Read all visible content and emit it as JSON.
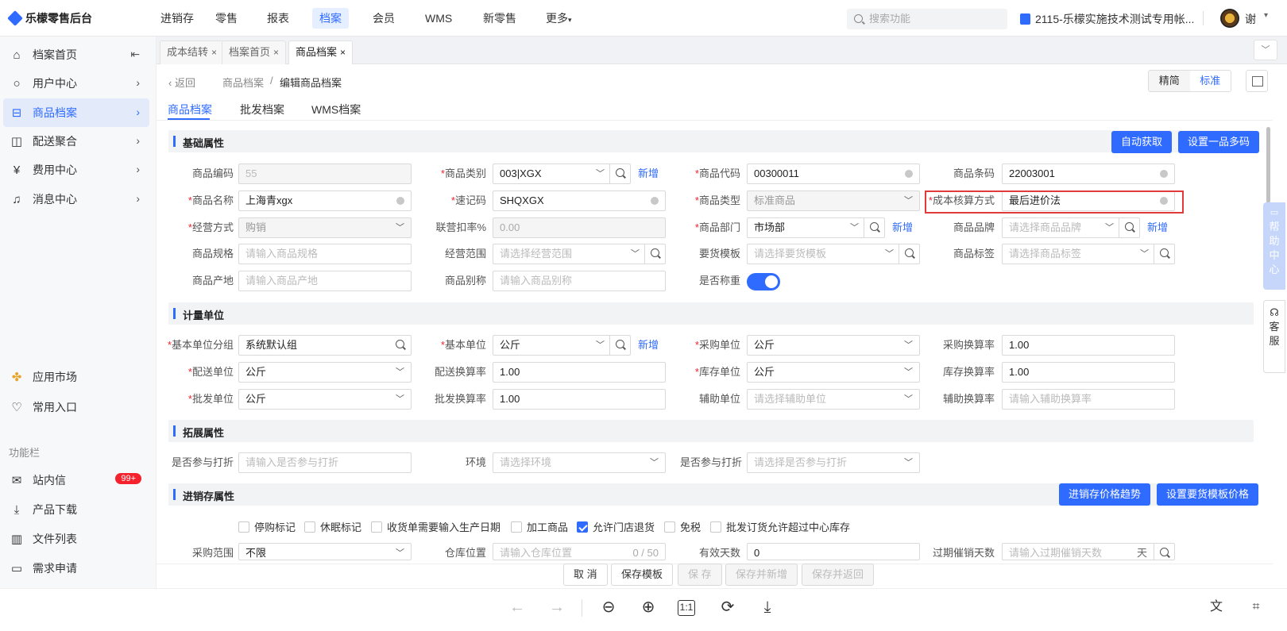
{
  "app": {
    "logo": "乐檬零售后台"
  },
  "topnav": [
    "进销存",
    "零售",
    "报表",
    "档案",
    "会员",
    "WMS",
    "新零售",
    "更多"
  ],
  "topnav_active": 3,
  "search": {
    "placeholder": "搜索功能"
  },
  "account": "2115-乐檬实施技术测试专用帐...",
  "user": "谢",
  "sidebar": {
    "items": [
      {
        "label": "档案首页",
        "icon": "home-icon"
      },
      {
        "label": "用户中心",
        "icon": "user-icon"
      },
      {
        "label": "商品档案",
        "icon": "product-icon"
      },
      {
        "label": "配送聚合",
        "icon": "delivery-icon"
      },
      {
        "label": "费用中心",
        "icon": "yen-icon"
      },
      {
        "label": "消息中心",
        "icon": "bell-icon"
      }
    ],
    "bottom": [
      {
        "label": "应用市场",
        "icon": "appstore-icon"
      },
      {
        "label": "常用入口",
        "icon": "heart-icon"
      }
    ],
    "fn_label": "功能栏",
    "fn_items": [
      {
        "label": "站内信",
        "icon": "mail-icon",
        "badge": "99+"
      },
      {
        "label": "产品下载",
        "icon": "download-icon"
      },
      {
        "label": "文件列表",
        "icon": "file-chart-icon"
      },
      {
        "label": "需求申请",
        "icon": "message-icon"
      }
    ]
  },
  "page_tabs": [
    "成本结转",
    "档案首页",
    "商品档案"
  ],
  "breadcrumb": {
    "back": "返回",
    "parent": "商品档案",
    "sep": "/",
    "current": "编辑商品档案"
  },
  "view_mode": {
    "simple": "精简",
    "standard": "标准"
  },
  "subtabs": [
    "商品档案",
    "批发档案",
    "WMS档案"
  ],
  "sections": {
    "basic": "基础属性",
    "unit": "计量单位",
    "ext": "拓展属性",
    "inv": "进销存属性"
  },
  "buttons": {
    "auto_get": "自动获取",
    "multi_code": "设置一品多码",
    "price_trend": "进销存价格趋势",
    "tpl_price": "设置要货模板价格",
    "add": "新增"
  },
  "basic": {
    "code_label": "商品编码",
    "code": "55",
    "category_label": "商品类别",
    "category": "003|XGX",
    "item_code_label": "商品代码",
    "item_code": "00300011",
    "barcode_label": "商品条码",
    "barcode": "22003001",
    "name_label": "商品名称",
    "name": "上海青xgx",
    "quick_label": "速记码",
    "quick": "SHQXGX",
    "type_label": "商品类型",
    "type": "标准商品",
    "cost_label": "成本核算方式",
    "cost": "最后进价法",
    "biz_label": "经营方式",
    "biz": "购销",
    "discount_label": "联营扣率%",
    "discount": "0.00",
    "dept_label": "商品部门",
    "dept": "市场部",
    "brand_label": "商品品牌",
    "brand_ph": "请选择商品品牌",
    "spec_label": "商品规格",
    "spec_ph": "请输入商品规格",
    "scope_label": "经营范围",
    "scope_ph": "请选择经营范围",
    "tpl_label": "要货模板",
    "tpl_ph": "请选择要货模板",
    "tag_label": "商品标签",
    "tag_ph": "请选择商品标签",
    "origin_label": "商品产地",
    "origin_ph": "请输入商品产地",
    "alias_label": "商品别称",
    "alias_ph": "请输入商品别称",
    "weigh_label": "是否称重"
  },
  "unit": {
    "group_label": "基本单位分组",
    "group": "系统默认组",
    "base_label": "基本单位",
    "base": "公斤",
    "purchase_label": "采购单位",
    "purchase": "公斤",
    "purchase_rate_label": "采购换算率",
    "purchase_rate": "1.00",
    "delivery_label": "配送单位",
    "delivery": "公斤",
    "delivery_rate_label": "配送换算率",
    "delivery_rate": "1.00",
    "stock_label": "库存单位",
    "stock": "公斤",
    "stock_rate_label": "库存换算率",
    "stock_rate": "1.00",
    "wholesale_label": "批发单位",
    "wholesale": "公斤",
    "wholesale_rate_label": "批发换算率",
    "wholesale_rate": "1.00",
    "aux_label": "辅助单位",
    "aux_ph": "请选择辅助单位",
    "aux_rate_label": "辅助换算率",
    "aux_rate_ph": "请输入辅助换算率"
  },
  "ext": {
    "disc1_label": "是否参与打折",
    "disc1_ph": "请输入是否参与打折",
    "env_label": "环境",
    "env_ph": "请选择环境",
    "disc2_label": "是否参与打折",
    "disc2_ph": "请选择是否参与打折"
  },
  "inv": {
    "checks": [
      {
        "label": "停购标记",
        "checked": false
      },
      {
        "label": "休眠标记",
        "checked": false
      },
      {
        "label": "收货单需要输入生产日期",
        "checked": false
      },
      {
        "label": "加工商品",
        "checked": false
      },
      {
        "label": "允许门店退货",
        "checked": true
      },
      {
        "label": "免税",
        "checked": false
      },
      {
        "label": "批发订货允许超过中心库存",
        "checked": false
      }
    ],
    "range_label": "采购范围",
    "range": "不限",
    "loc_label": "仓库位置",
    "loc_ph": "请输入仓库位置",
    "loc_count": "0 / 50",
    "days_label": "有效天数",
    "days": "0",
    "expire_label": "过期催销天数",
    "expire_ph": "请输入过期催销天数",
    "expire_unit": "天"
  },
  "actions": [
    "取 消",
    "保存模板",
    "保 存",
    "保存并新增",
    "保存并返回"
  ],
  "help": [
    "帮",
    "助",
    "中",
    "心"
  ],
  "kefu": [
    "客",
    "服"
  ]
}
